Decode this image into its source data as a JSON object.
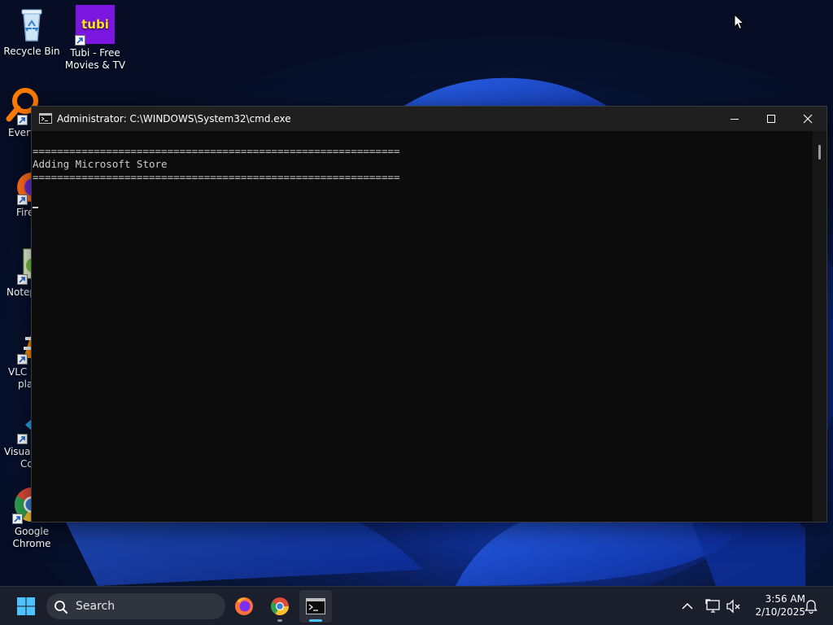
{
  "desktop": {
    "icons": [
      {
        "id": "recycle-bin",
        "label_lines": [
          "Recycle Bin"
        ],
        "icon": "recycle-bin-icon"
      },
      {
        "id": "tubi",
        "label_lines": [
          "Tubi - Free",
          "Movies & TV"
        ],
        "icon": "tubi-icon",
        "logo_text": "tubi"
      },
      {
        "id": "everything",
        "label_lines": [
          "Every"
        ],
        "icon": "everything-search-icon"
      },
      {
        "id": "firefox",
        "label_lines": [
          "Fire"
        ],
        "icon": "firefox-icon"
      },
      {
        "id": "notepad",
        "label_lines": [
          "Notep"
        ],
        "icon": "notepad-plus-plus-icon"
      },
      {
        "id": "vlc",
        "label_lines": [
          "VLC m",
          "pla"
        ],
        "icon": "vlc-icon"
      },
      {
        "id": "vscode",
        "label_lines": [
          "Visual",
          "Co"
        ],
        "icon": "vscode-icon"
      },
      {
        "id": "chrome",
        "label_lines": [
          "Google",
          "Chrome"
        ],
        "icon": "chrome-icon"
      }
    ]
  },
  "cmd": {
    "title": "Administrator: C:\\WINDOWS\\System32\\cmd.exe",
    "icon": "cmd-icon",
    "lines": [
      "============================================================",
      "Adding Microsoft Store",
      "============================================================"
    ],
    "colors": {
      "background": "#0c0c0c",
      "text": "#cccccc",
      "titlebar": "#1f1f1f"
    }
  },
  "taskbar": {
    "start_icon": "windows-start-icon",
    "search_placeholder": "Search",
    "pinned": [
      {
        "id": "firefox",
        "icon": "firefox-icon"
      },
      {
        "id": "chrome",
        "icon": "chrome-icon"
      },
      {
        "id": "cmd",
        "icon": "cmd-icon",
        "active": true
      }
    ],
    "tray": {
      "chevron_icon": "chevron-up-icon",
      "network_icon": "network-icon",
      "volume_icon": "volume-muted-icon",
      "notification_icon": "bell-icon"
    },
    "clock": {
      "time": "3:56 AM",
      "date": "2/10/2025"
    },
    "accent": "#4cc2ff"
  }
}
